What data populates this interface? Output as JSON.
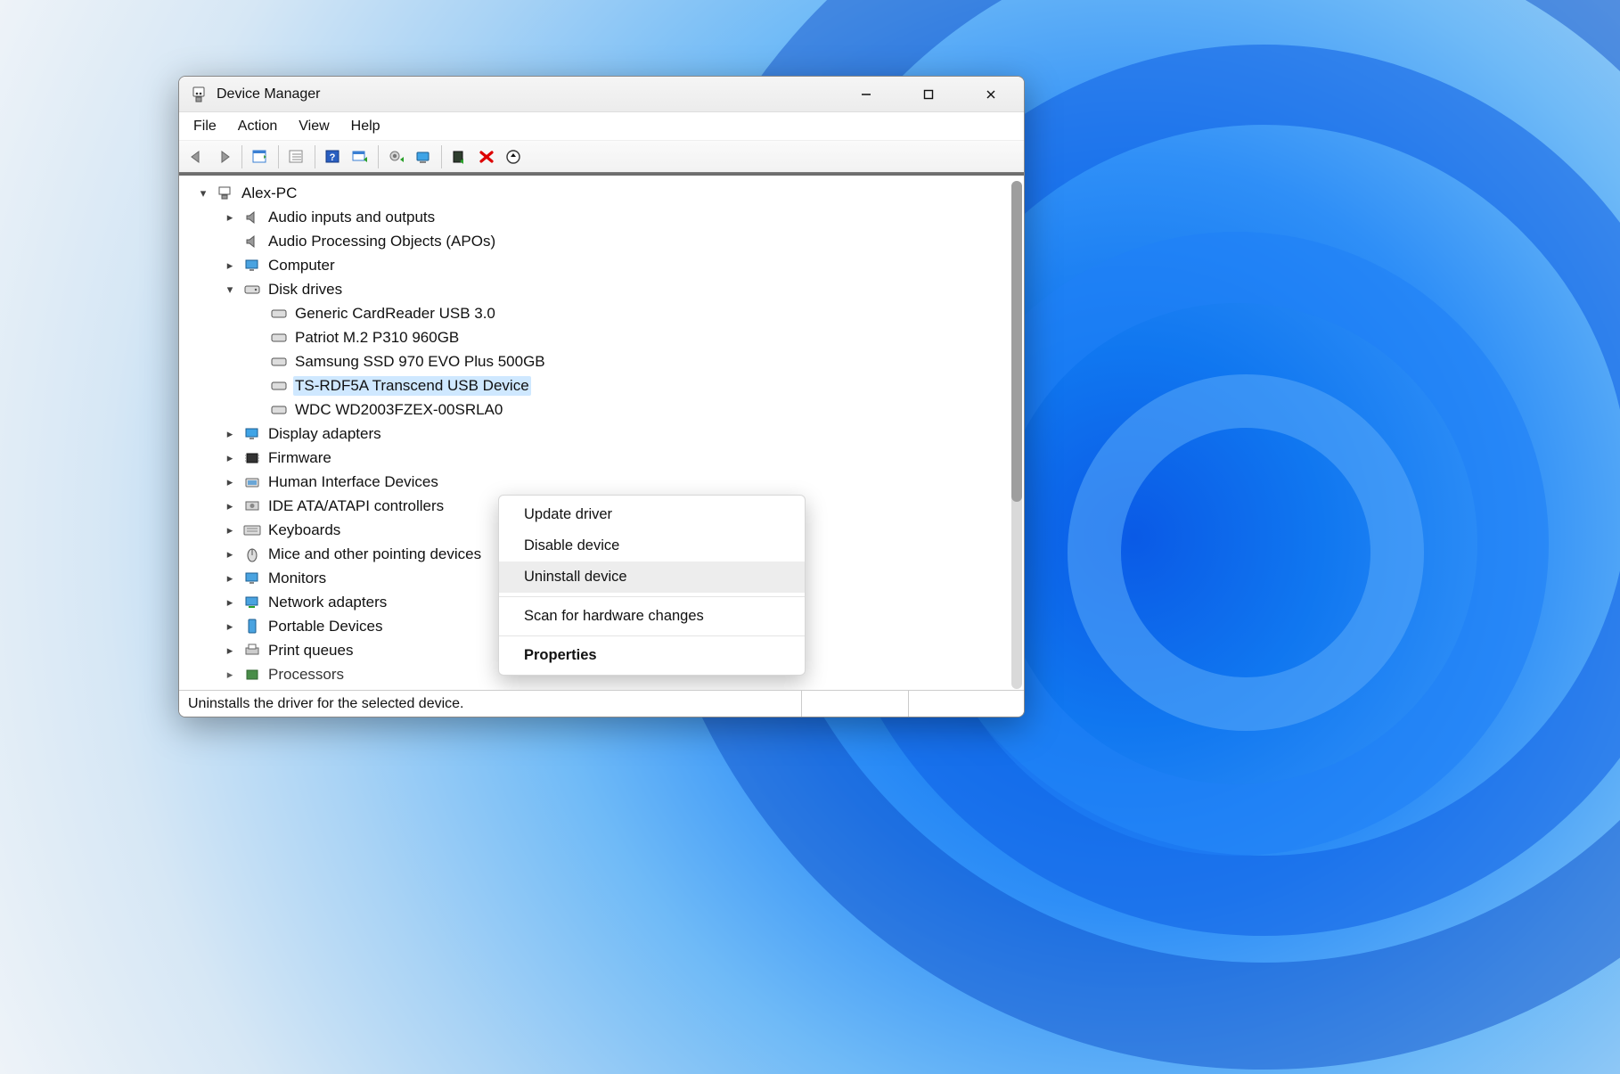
{
  "window": {
    "title": "Device Manager"
  },
  "menubar": {
    "file": "File",
    "action": "Action",
    "view": "View",
    "help": "Help"
  },
  "tree": {
    "root": "Alex-PC",
    "audio_io": "Audio inputs and outputs",
    "audio_apo": "Audio Processing Objects (APOs)",
    "computer": "Computer",
    "disk_drives": "Disk drives",
    "disk0": "Generic CardReader USB 3.0",
    "disk1": "Patriot M.2 P310 960GB",
    "disk2": "Samsung SSD 970 EVO Plus 500GB",
    "disk3": "TS-RDF5A Transcend USB Device",
    "disk4": "WDC WD2003FZEX-00SRLA0",
    "display": "Display adapters",
    "firmware": "Firmware",
    "hid": "Human Interface Devices",
    "ide": "IDE ATA/ATAPI controllers",
    "keyboards": "Keyboards",
    "mice": "Mice and other pointing devices",
    "monitors": "Monitors",
    "network": "Network adapters",
    "portable": "Portable Devices",
    "print": "Print queues",
    "processors": "Processors"
  },
  "context_menu": {
    "update": "Update driver",
    "disable": "Disable device",
    "uninstall": "Uninstall device",
    "scan": "Scan for hardware changes",
    "properties": "Properties"
  },
  "statusbar": {
    "text": "Uninstalls the driver for the selected device."
  }
}
